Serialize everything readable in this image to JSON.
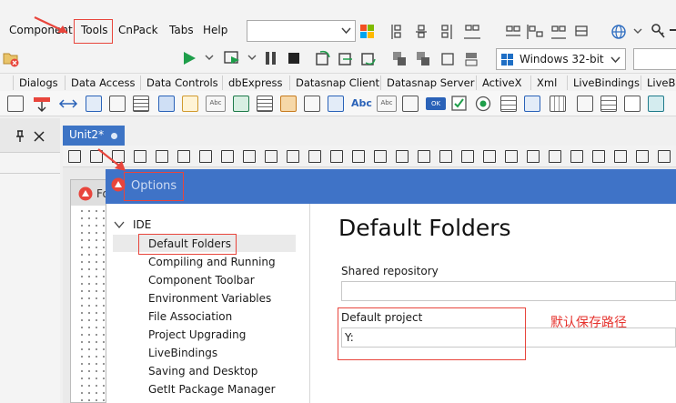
{
  "menu": {
    "items": [
      "Component",
      "Tools",
      "CnPack",
      "Tabs",
      "Help"
    ]
  },
  "toolbar": {
    "platform_value": "Windows 32-bit"
  },
  "palette": {
    "tabs": [
      "Dialogs",
      "Data Access",
      "Data Controls",
      "dbExpress",
      "Datasnap Client",
      "Datasnap Server",
      "ActiveX",
      "Xml",
      "LiveBindings",
      "LiveBi"
    ]
  },
  "editor": {
    "tab_label": "Unit2*",
    "form_caption": "Fo"
  },
  "options": {
    "title": "Options",
    "tree_root": "IDE",
    "tree_items": [
      "Default Folders",
      "Compiling and Running",
      "Component Toolbar",
      "Environment Variables",
      "File Association",
      "Project Upgrading",
      "LiveBindings",
      "Saving and Desktop",
      "GetIt Package Manager"
    ],
    "page_heading": "Default Folders",
    "shared_repository_label": "Shared repository",
    "shared_repository_value": "",
    "default_project_label": "Default project",
    "default_project_value": "Y:",
    "annotation": "默认保存路径"
  },
  "colors": {
    "accent_blue": "#3f73c7",
    "annotation_red": "#e5322d"
  }
}
